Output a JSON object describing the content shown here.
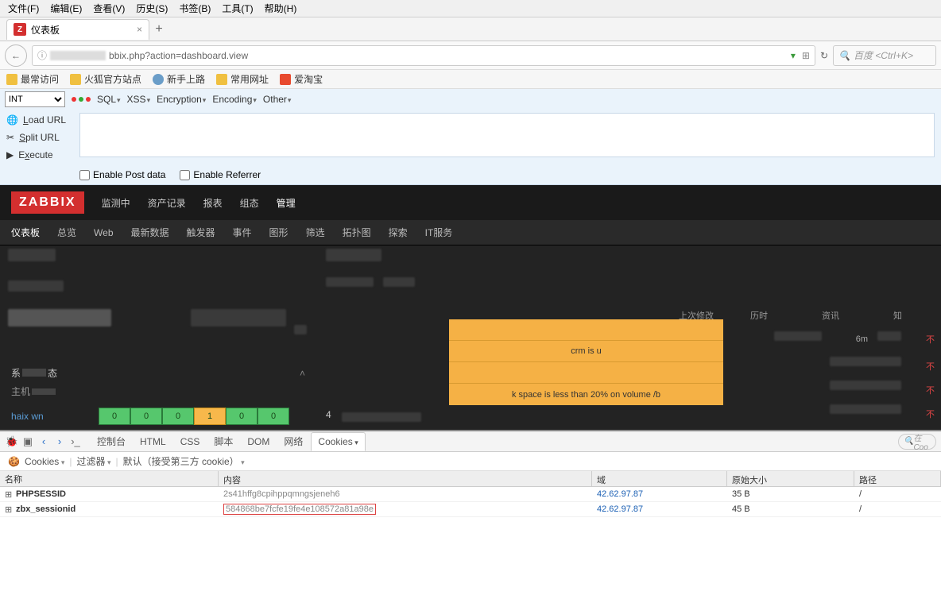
{
  "menubar": [
    "文件(F)",
    "编辑(E)",
    "查看(V)",
    "历史(S)",
    "书签(B)",
    "工具(T)",
    "帮助(H)"
  ],
  "tab": {
    "title": "仪表板"
  },
  "url": {
    "visible": "bbix.php?action=dashboard.view",
    "search_placeholder": "百度 <Ctrl+K>"
  },
  "bookmarks": [
    "最常访问",
    "火狐官方站点",
    "新手上路",
    "常用网址",
    "爱淘宝"
  ],
  "hackbar": {
    "select": "INT",
    "menus": [
      "SQL",
      "XSS",
      "Encryption",
      "Encoding",
      "Other"
    ],
    "left": [
      "Load URL",
      "Split URL",
      "Execute"
    ],
    "checks": [
      "Enable Post data",
      "Enable Referrer"
    ]
  },
  "zabbix": {
    "logo": "ZABBIX",
    "nav": [
      "监测中",
      "资产记录",
      "报表",
      "组态",
      "管理"
    ],
    "nav_active": 4,
    "subnav": [
      "仪表板",
      "总览",
      "Web",
      "最新数据",
      "触发器",
      "事件",
      "图形",
      "筛选",
      "拓扑图",
      "探索",
      "IT服务"
    ],
    "subnav_active": 0,
    "sys_label": "系",
    "sys_label2": "态",
    "host_label": "主机",
    "host_name": "haix        wn",
    "cells": [
      "0",
      "0",
      "0",
      "1",
      "0",
      "0"
    ],
    "cell_warn_index": 3,
    "cols": [
      "上次修改于",
      "历时",
      "资讯",
      "知"
    ],
    "alert_rows": [
      "",
      "crm is u",
      "",
      "k space is less than 20% on volume /b"
    ],
    "panel_r_num": "4",
    "duration": "6m",
    "red_flag": "不"
  },
  "devtools": {
    "tabs": [
      "控制台",
      "HTML",
      "CSS",
      "脚本",
      "DOM",
      "网络",
      "Cookies"
    ],
    "active_tab": 6,
    "sub": {
      "cookies": "Cookies",
      "filter": "过滤器",
      "default": "默认（接受第三方 cookie）"
    },
    "search_hint": "在 Coo",
    "headers": [
      "名称",
      "内容",
      "域",
      "原始大小",
      "路径"
    ],
    "rows": [
      {
        "name": "PHPSESSID",
        "content": "2s41hffg8cpihppqmngsjeneh6",
        "domain": "42.62.97.87",
        "size": "35 B",
        "path": "/",
        "highlight": false
      },
      {
        "name": "zbx_sessionid",
        "content": "584868be7fcfe19fe4e108572a81a98e",
        "domain": "42.62.97.87",
        "size": "45 B",
        "path": "/",
        "highlight": true
      }
    ]
  }
}
